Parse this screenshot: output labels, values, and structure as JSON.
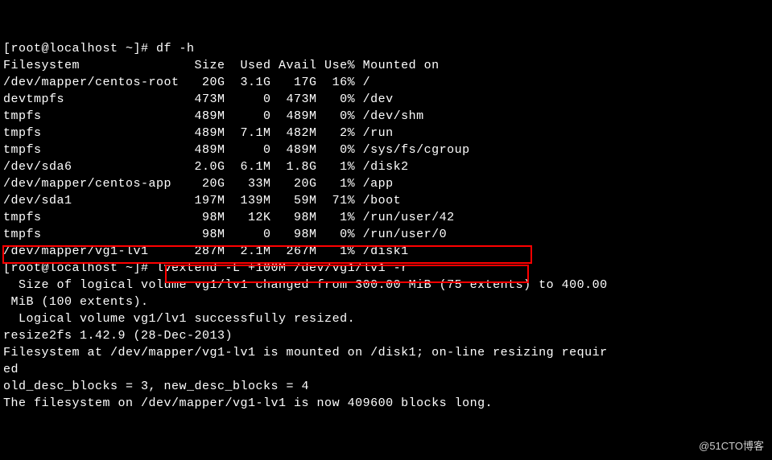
{
  "prompt1": "[root@localhost ~]# ",
  "cmd1": "df -h",
  "header": "Filesystem               Size  Used Avail Use% Mounted on",
  "rows": [
    "/dev/mapper/centos-root   20G  3.1G   17G  16% /",
    "devtmpfs                 473M     0  473M   0% /dev",
    "tmpfs                    489M     0  489M   0% /dev/shm",
    "tmpfs                    489M  7.1M  482M   2% /run",
    "tmpfs                    489M     0  489M   0% /sys/fs/cgroup",
    "/dev/sda6                2.0G  6.1M  1.8G   1% /disk2",
    "/dev/mapper/centos-app    20G   33M   20G   1% /app",
    "/dev/sda1                197M  139M   59M  71% /boot",
    "tmpfs                     98M   12K   98M   1% /run/user/42",
    "tmpfs                     98M     0   98M   0% /run/user/0",
    "/dev/mapper/vg1-lv1      287M  2.1M  267M   1% /disk1"
  ],
  "prompt2": "[root@localhost ~]# ",
  "cmd2": "lvextend -L +100M /dev/vg1/lv1 -r",
  "out1": "  Size of logical volume vg1/lv1 changed from 300.00 MiB (75 extents) to 400.00",
  "out2": " MiB (100 extents).",
  "out3": "  Logical volume vg1/lv1 successfully resized.",
  "out4": "resize2fs 1.42.9 (28-Dec-2013)",
  "out5": "Filesystem at /dev/mapper/vg1-lv1 is mounted on /disk1; on-line resizing requir",
  "out6": "ed",
  "out7": "old_desc_blocks = 3, new_desc_blocks = 4",
  "out8": "The filesystem on /dev/mapper/vg1-lv1 is now 409600 blocks long.",
  "watermark": "@51CTO博客"
}
